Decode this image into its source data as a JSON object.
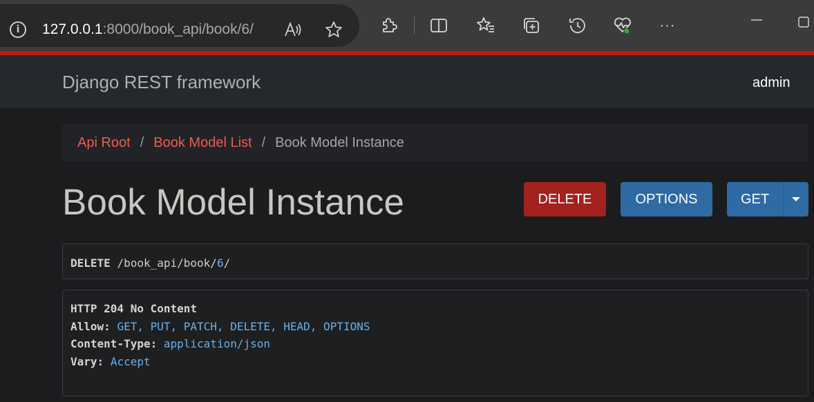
{
  "browser": {
    "url_host": "127.0.0.1",
    "url_rest": ":8000/book_api/book/6/",
    "info_glyph": "i",
    "more_glyph": "···",
    "icons": [
      "info-icon",
      "read-aloud-icon",
      "favorite-star-icon",
      "extensions-icon",
      "split-screen-icon",
      "favorites-icon",
      "collections-icon",
      "history-icon",
      "browser-essentials-icon",
      "more-icon",
      "minimize-icon",
      "maximize-icon"
    ],
    "accent_color": "#c51a10"
  },
  "navbar": {
    "brand": "Django REST framework",
    "user": "admin"
  },
  "breadcrumb": {
    "items": [
      {
        "label": "Api Root",
        "link": true
      },
      {
        "label": "Book Model List",
        "link": true
      },
      {
        "label": "Book Model Instance",
        "link": false
      }
    ],
    "separator": "/"
  },
  "page": {
    "title": "Book Model Instance"
  },
  "actions": {
    "delete_label": "DELETE",
    "options_label": "OPTIONS",
    "get_label": "GET",
    "colors": {
      "delete": "#a3221e",
      "primary": "#2e6aa3"
    }
  },
  "request": {
    "method": "DELETE",
    "path_prefix": "/book_api/book/",
    "path_id": "6",
    "path_suffix": "/"
  },
  "response": {
    "status": "HTTP 204 No Content",
    "headers": [
      {
        "key": "Allow:",
        "value": "GET, PUT, PATCH, DELETE, HEAD, OPTIONS"
      },
      {
        "key": "Content-Type:",
        "value": "application/json"
      },
      {
        "key": "Vary:",
        "value": "Accept"
      }
    ]
  }
}
